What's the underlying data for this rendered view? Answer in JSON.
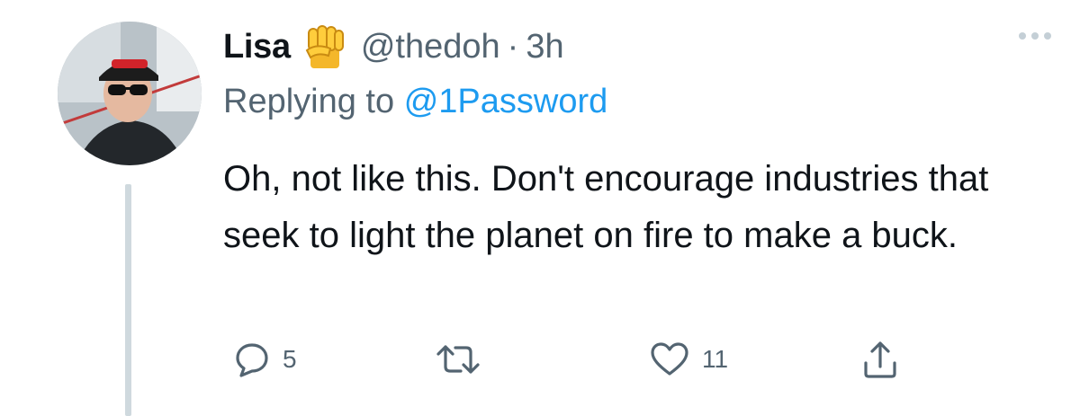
{
  "tweet": {
    "author": {
      "name": "Lisa",
      "handle": "@thedoh",
      "badge_icon": "raised-fist-emoji"
    },
    "separator": "·",
    "time": "3h",
    "replying": {
      "prefix": "Replying to",
      "mention": "@1Password"
    },
    "text": "Oh, not like this. Don't encourage industries that seek to light the planet on fire to make a buck.",
    "actions": {
      "reply": {
        "icon": "reply-icon",
        "count": "5"
      },
      "retweet": {
        "icon": "retweet-icon",
        "count": ""
      },
      "like": {
        "icon": "like-icon",
        "count": "11"
      },
      "share": {
        "icon": "share-icon"
      }
    }
  },
  "colors": {
    "text": "#0f1419",
    "secondary": "#536471",
    "link": "#1d9bf0",
    "thread": "#cfd9de"
  }
}
